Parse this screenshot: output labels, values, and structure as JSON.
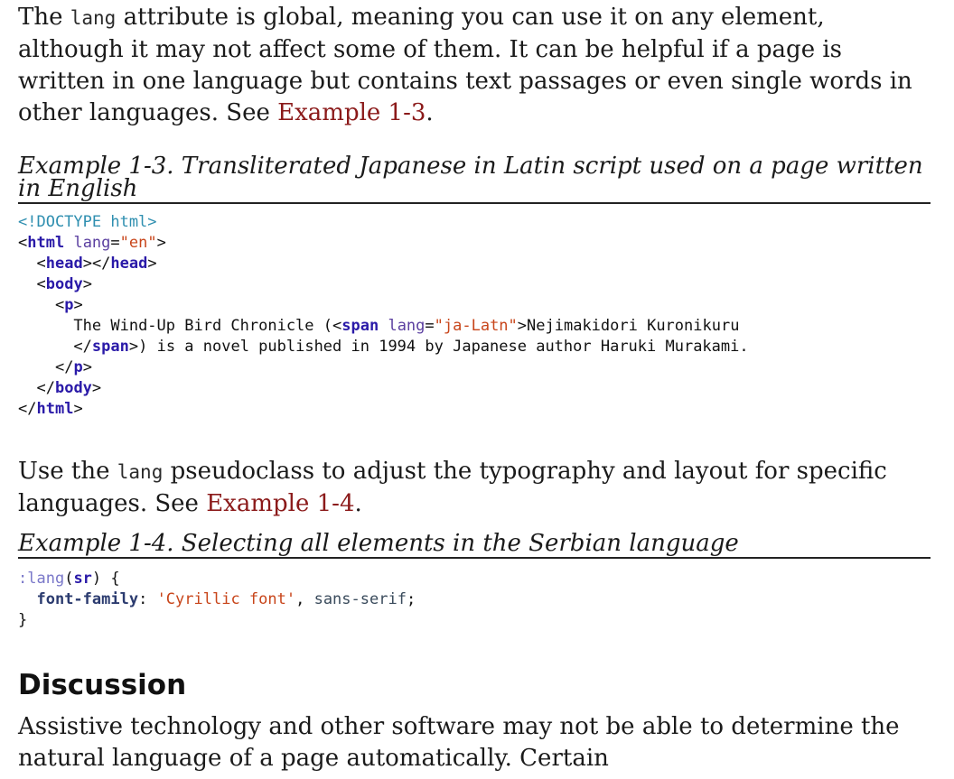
{
  "paragraph1": {
    "text_a": "The ",
    "code": "lang",
    "text_b": " attribute is global, meaning you can use it on any element, although it may not affect some of them. It can be helpful if a page is written in one language but contains text passages or even single words in other languages. See ",
    "link": "Example 1-3",
    "text_c": "."
  },
  "example1": {
    "caption": "Example 1-3. Transliterated Japanese in Latin script used on a page written in English",
    "code": {
      "l1": "<!DOCTYPE html>",
      "lt": "<",
      "gt": ">",
      "lts": "</",
      "eq": "=",
      "html": "html",
      "head": "head",
      "body": "body",
      "p": "p",
      "span": "span",
      "lang_attr": "lang",
      "en": "\"en\"",
      "ja": "\"ja-Latn\"",
      "indent2": "  ",
      "indent4": "    ",
      "indent6": "      ",
      "text1": "The Wind-Up Bird Chronicle (",
      "text2": "Nejimakidori Kuronikuru",
      "text3": ") is a novel published in 1994 by Japanese author Haruki Murakami."
    }
  },
  "paragraph2": {
    "text_a": "Use the ",
    "code": "lang",
    "text_b": " pseudoclass to adjust the typography and layout for specific languages. See ",
    "link": "Example 1-4",
    "text_c": "."
  },
  "example2": {
    "caption": "Example 1-4. Selecting all elements in the Serbian language",
    "code": {
      "pseudo": ":lang",
      "open": "(",
      "arg": "sr",
      "close": ") {",
      "indent": "  ",
      "prop": "font-family",
      "colon": ": ",
      "str": "'Cyrillic font'",
      "comma": ", ",
      "ident": "sans-serif",
      "semi": ";",
      "brace": "}"
    }
  },
  "discussion": {
    "heading": "Discussion",
    "text": "Assistive technology and other software may not be able to determine the natural language of a page automatically. Certain"
  },
  "colors": {
    "link": "#8b1a1a",
    "tag": "#2a1aa8",
    "attribute": "#5b3fa0",
    "string": "#c8451a",
    "doctype": "#2f8fb0"
  }
}
